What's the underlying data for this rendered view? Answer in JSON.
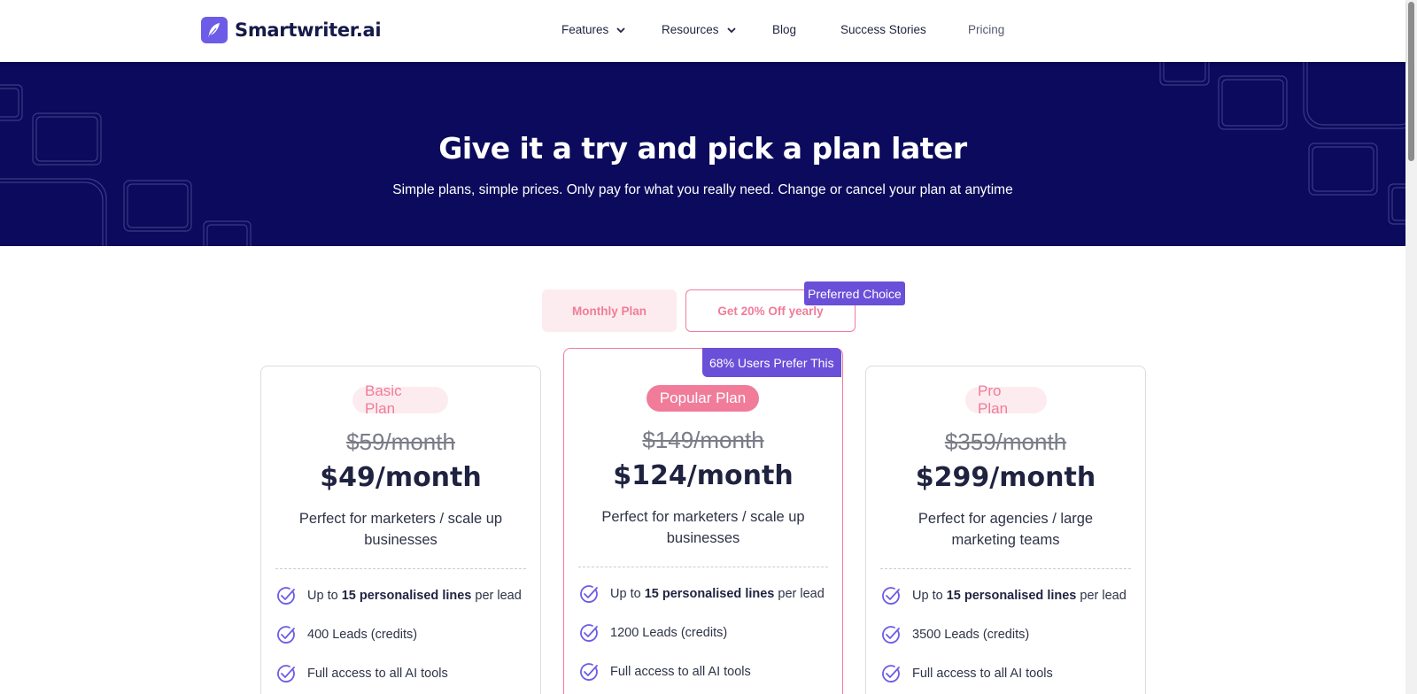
{
  "brand": {
    "name": "Smartwriter.ai",
    "accent": "#6c5ce7"
  },
  "nav": {
    "features": "Features",
    "resources": "Resources",
    "blog": "Blog",
    "success_stories": "Success Stories",
    "pricing": "Pricing"
  },
  "hero": {
    "title": "Give it a try and pick a plan later",
    "subtitle": "Simple plans, simple prices. Only pay for what you really need. Change or cancel your plan at anytime",
    "background": "#0b0a5c"
  },
  "toggle": {
    "monthly_label": "Monthly Plan",
    "yearly_label": "Get 20% Off yearly",
    "preferred_badge": "Preferred Choice"
  },
  "colors": {
    "pink": "#f07c9a",
    "purple_badge": "#6a4fd8"
  },
  "plans": [
    {
      "name": "Basic Plan",
      "old_price": "$59/month",
      "price": "$49/month",
      "description": "Perfect for marketers / scale up businesses",
      "features": [
        {
          "prefix": "Up to ",
          "bold": "15 personalised lines",
          "suffix": " per lead"
        },
        {
          "prefix": "400 Leads (credits)",
          "bold": "",
          "suffix": ""
        },
        {
          "prefix": "Full access to all AI tools",
          "bold": "",
          "suffix": ""
        }
      ]
    },
    {
      "name": "Popular Plan",
      "badge": "68% Users Prefer This",
      "old_price": "$149/month",
      "price": "$124/month",
      "description": "Perfect for marketers / scale up businesses",
      "features": [
        {
          "prefix": "Up to ",
          "bold": "15 personalised lines",
          "suffix": " per lead"
        },
        {
          "prefix": "1200 Leads (credits)",
          "bold": "",
          "suffix": ""
        },
        {
          "prefix": "Full access to all AI tools",
          "bold": "",
          "suffix": ""
        }
      ]
    },
    {
      "name": "Pro Plan",
      "old_price": "$359/month",
      "price": "$299/month",
      "description": "Perfect for agencies / large marketing teams",
      "features": [
        {
          "prefix": "Up to ",
          "bold": "15 personalised lines",
          "suffix": " per lead"
        },
        {
          "prefix": "3500 Leads (credits)",
          "bold": "",
          "suffix": ""
        },
        {
          "prefix": "Full access to all AI tools",
          "bold": "",
          "suffix": ""
        }
      ]
    }
  ]
}
